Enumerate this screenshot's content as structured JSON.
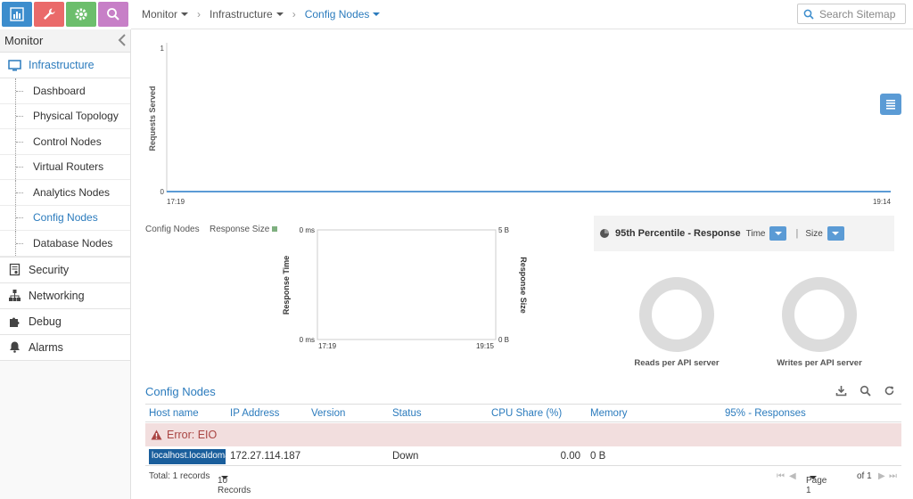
{
  "toolbar": {
    "buttons": [
      {
        "name": "monitor",
        "color": "#3c8dcd"
      },
      {
        "name": "configure",
        "color": "#ea6a6a"
      },
      {
        "name": "settings",
        "color": "#6cbe6c"
      },
      {
        "name": "query",
        "color": "#c77fc7"
      }
    ]
  },
  "header": {
    "breadcrumbs": [
      "Monitor",
      "Infrastructure",
      "Config Nodes"
    ],
    "search_placeholder": "Search Sitemap"
  },
  "sidebar": {
    "title": "Monitor",
    "sections": [
      {
        "label": "Infrastructure",
        "active": true
      },
      {
        "label": "Security"
      },
      {
        "label": "Networking"
      },
      {
        "label": "Debug"
      },
      {
        "label": "Alarms"
      }
    ],
    "items": [
      {
        "label": "Dashboard"
      },
      {
        "label": "Physical Topology"
      },
      {
        "label": "Control Nodes"
      },
      {
        "label": "Virtual Routers"
      },
      {
        "label": "Analytics Nodes"
      },
      {
        "label": "Config Nodes",
        "active": true
      },
      {
        "label": "Database Nodes"
      }
    ]
  },
  "chart_data": [
    {
      "type": "line",
      "ylabel": "Requests Served",
      "yticks": [
        "1",
        "0"
      ],
      "xticks": [
        "17:19",
        "19:14"
      ],
      "ylim": [
        0,
        1
      ],
      "series": [
        {
          "values": [
            0,
            0
          ]
        }
      ]
    },
    {
      "type": "line",
      "legend": [
        "Config Nodes",
        "Response Size"
      ],
      "ylabel_left": "Response Time",
      "ylabel_right": "Response Size",
      "yticks_left": [
        "0 ms",
        "0 ms"
      ],
      "yticks_right": [
        "5 B",
        "0 B"
      ],
      "xticks": [
        "17:19",
        "19:15"
      ]
    }
  ],
  "percentile": {
    "title": "95th Percentile - Response",
    "time_label": "Time",
    "size_label": "Size",
    "divider": "|"
  },
  "donuts": [
    {
      "label": "Reads per API server"
    },
    {
      "label": "Writes per API server"
    }
  ],
  "grid": {
    "title": "Config Nodes",
    "columns": [
      "Host name",
      "IP Address",
      "Version",
      "Status",
      "CPU Share (%)",
      "Memory",
      "95% - Responses"
    ],
    "error": "Error: EIO",
    "rows": [
      {
        "host": "localhost.localdoma",
        "ip": "172.27.114.187",
        "version": "",
        "status": "Down",
        "cpu": "0.00",
        "memory": "0 B",
        "responses": ""
      }
    ],
    "footer": {
      "total": "Total: 1 records",
      "page_size": "10 Records",
      "page": "Page 1",
      "of": "of 1"
    }
  }
}
